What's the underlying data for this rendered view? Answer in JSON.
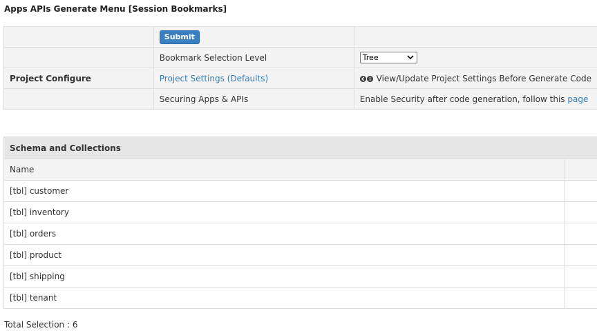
{
  "page": {
    "title": "Apps APIs Generate Menu [Session Bookmarks]"
  },
  "config": {
    "submit_label": "Submit",
    "bookmark_level_label": "Bookmark Selection Level",
    "bookmark_level_value": "Tree",
    "project_configure_label": "Project Configure",
    "project_settings_link": "Project Settings (Defaults)",
    "view_update_text": "View/Update Project Settings Before Generate Code",
    "securing_label": "Securing Apps & APIs",
    "security_text": "Enable Security after code generation, follow this",
    "security_link": "page"
  },
  "schema": {
    "title": "Schema and Collections",
    "name_header": "Name",
    "rows": [
      "[tbl] customer",
      "[tbl] inventory",
      "[tbl] orders",
      "[tbl] product",
      "[tbl] shipping",
      "[tbl] tenant"
    ]
  },
  "footer": {
    "total_selection": "Total Selection : 6"
  },
  "colors": {
    "accent": "#3a7fc1",
    "link": "#337ab7",
    "header_bg": "#e6e6e6",
    "row_alt_bg": "#f4f4f4"
  }
}
